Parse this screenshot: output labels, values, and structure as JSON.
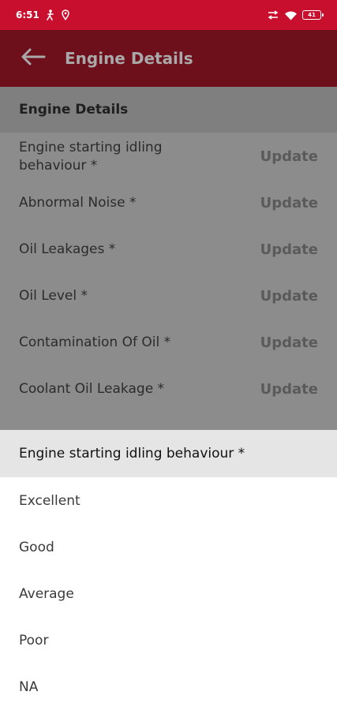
{
  "status_bar": {
    "time": "6:51",
    "battery": "41"
  },
  "app_bar": {
    "title": "Engine Details"
  },
  "section": {
    "title": "Engine Details"
  },
  "rows": [
    {
      "label": "Engine starting idling behaviour *",
      "action": "Update"
    },
    {
      "label": "Abnormal Noise *",
      "action": "Update"
    },
    {
      "label": "Oil Leakages *",
      "action": "Update"
    },
    {
      "label": "Oil Level *",
      "action": "Update"
    },
    {
      "label": "Contamination Of Oil *",
      "action": "Update"
    },
    {
      "label": "Coolant Oil Leakage *",
      "action": "Update"
    }
  ],
  "sheet": {
    "title": "Engine starting idling behaviour *",
    "options": [
      "Excellent",
      "Good",
      "Average",
      "Poor",
      "NA"
    ]
  },
  "colors": {
    "status_bar": "#c8102e",
    "app_bar_dimmed": "#6e0f1c",
    "overlay_gray": "#8c8c8c"
  }
}
